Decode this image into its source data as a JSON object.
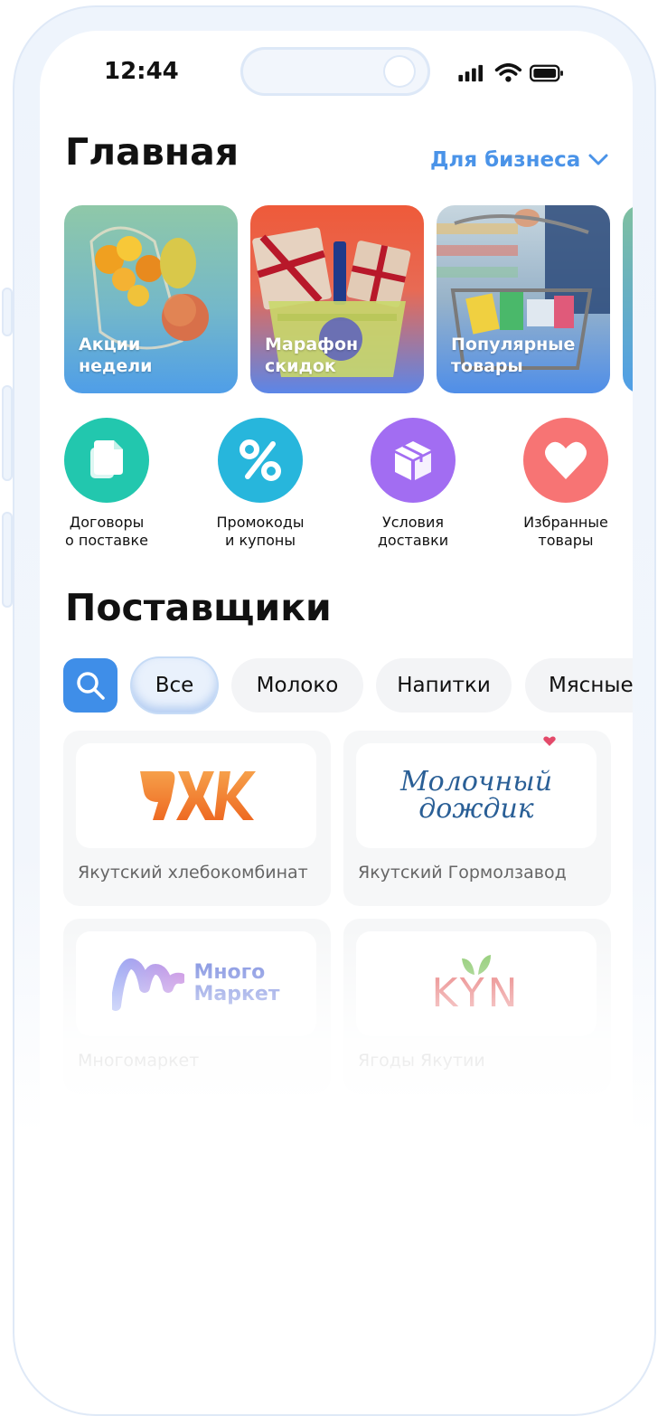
{
  "status": {
    "time": "12:44"
  },
  "header": {
    "title": "Главная",
    "business_link": "Для бизнеса"
  },
  "stories": [
    {
      "label": "Акции\nнедели"
    },
    {
      "label": "Марафон\nскидок"
    },
    {
      "label": "Популярные\nтовары"
    }
  ],
  "quick_actions": [
    {
      "label": "Договоры\nо поставке",
      "icon": "document-icon",
      "color": "#22c7ae"
    },
    {
      "label": "Промокоды\nи купоны",
      "icon": "percent-icon",
      "color": "#27b6dc"
    },
    {
      "label": "Условия\nдоставки",
      "icon": "box-icon",
      "color": "#a26df2"
    },
    {
      "label": "Избранные\nтовары",
      "icon": "heart-icon",
      "color": "#f77474"
    }
  ],
  "suppliers": {
    "title": "Поставщики",
    "filters": [
      "Все",
      "Молоко",
      "Напитки",
      "Мясные"
    ],
    "active_filter": "Все",
    "cards": [
      {
        "name": "Якутский хлебокомбинат",
        "logo_text": "ЯХК"
      },
      {
        "name": "Якутский Гормолзавод",
        "logo_text": "Молочный\nдождик"
      },
      {
        "name": "Многомаркет",
        "logo_text": "Много\nМаркет"
      },
      {
        "name": "Ягоды Якутии",
        "logo_text": "KYN"
      }
    ]
  },
  "colors": {
    "accent": "#4a93e8",
    "search_button": "#3f8ee8"
  }
}
